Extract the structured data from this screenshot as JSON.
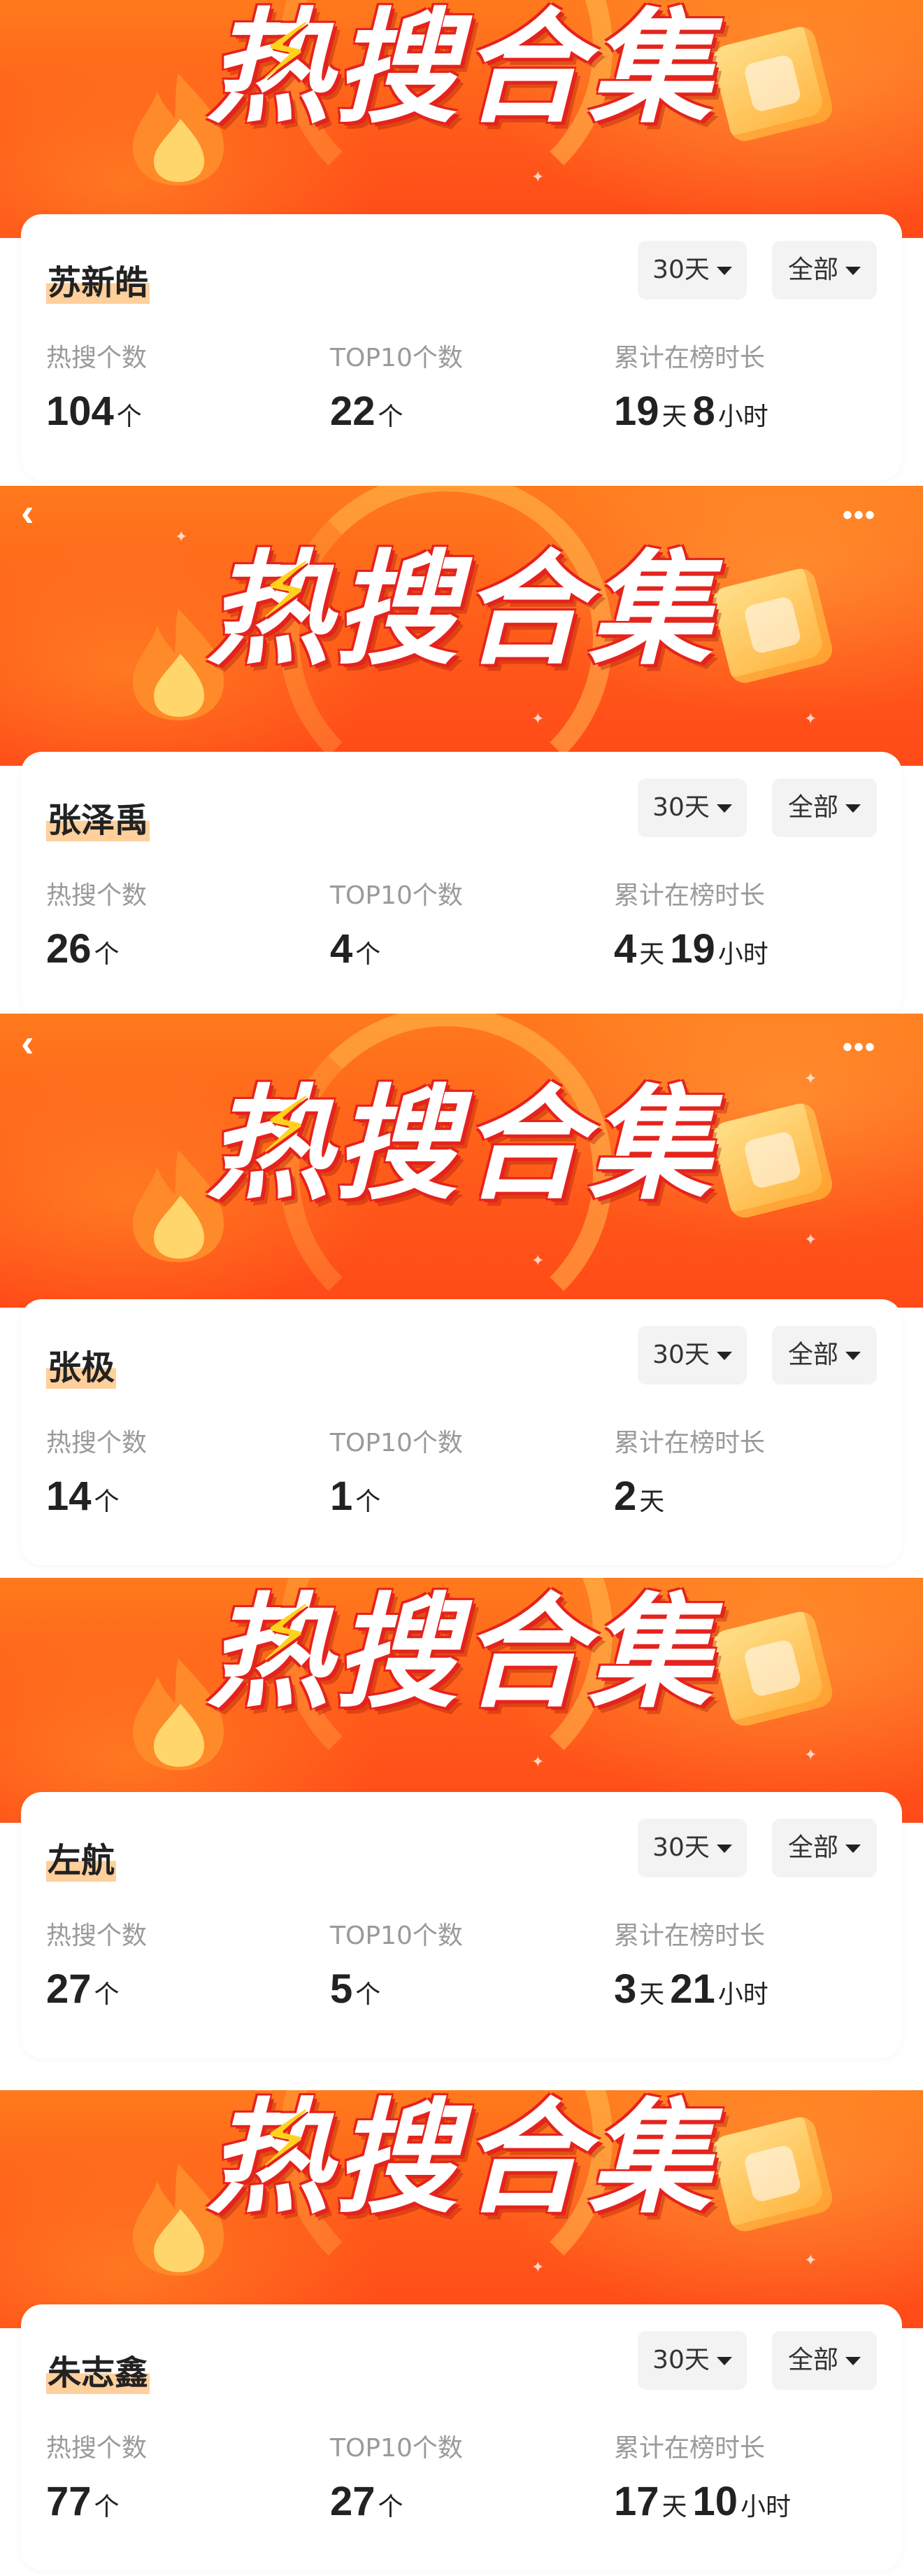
{
  "banner": {
    "title": "热搜合集",
    "bolt_icon": "lightning-bolt-icon",
    "back_icon": "‹",
    "more_icon": "•••"
  },
  "stat_labels": {
    "hot_count": "热搜个数",
    "top10_count": "TOP10个数",
    "total_time": "累计在榜时长"
  },
  "units": {
    "count": "个",
    "day": "天",
    "hour": "小时"
  },
  "filters": {
    "days_label": "30天",
    "scope_label": "全部"
  },
  "cards": [
    {
      "name": "苏新皓",
      "hot_count": "104",
      "top10_count": "22",
      "days": "19",
      "hours": "8"
    },
    {
      "name": "张泽禹",
      "hot_count": "26",
      "top10_count": "4",
      "days": "4",
      "hours": "19"
    },
    {
      "name": "张极",
      "hot_count": "14",
      "top10_count": "1",
      "days": "2",
      "hours": ""
    },
    {
      "name": "左航",
      "hot_count": "27",
      "top10_count": "5",
      "days": "3",
      "hours": "21"
    },
    {
      "name": "朱志鑫",
      "hot_count": "77",
      "top10_count": "27",
      "days": "17",
      "hours": "10"
    }
  ],
  "colors": {
    "banner_orange": "#ff5a1a",
    "title_red": "#e5231d",
    "name_highlight": "#ffcf9c",
    "bolt_yellow": "#ffd21d"
  }
}
